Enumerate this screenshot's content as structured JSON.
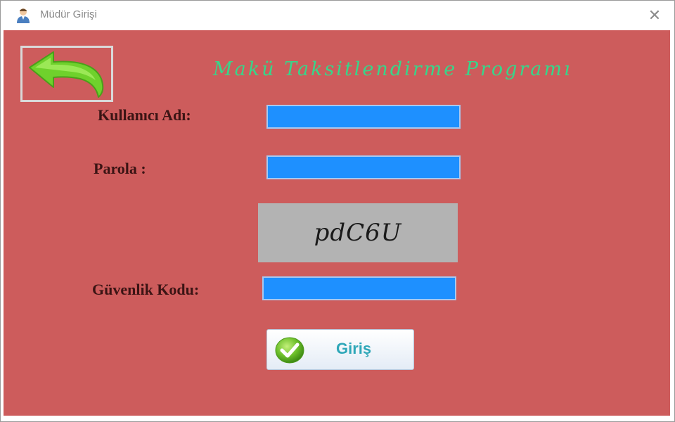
{
  "window": {
    "title": "Müdür Girişi",
    "close_glyph": "✕",
    "icon": "user-avatar-icon"
  },
  "header": {
    "back_icon": "back-arrow-icon",
    "app_title": "Makü Taksitlendirme Programı"
  },
  "form": {
    "username_label": "Kullanıcı Adı:",
    "username_value": "",
    "password_label": "Parola :",
    "password_value": "",
    "captcha_code": "pdC6U",
    "security_label": "Güvenlik Kodu:",
    "security_value": "",
    "login_label": "Giriş",
    "login_icon": "check-icon"
  },
  "colors": {
    "background": "#cd5c5c",
    "field": "#1e90ff",
    "title": "#37d68a",
    "captcha_bg": "#b3b3b3",
    "login_text": "#2ea7b8"
  }
}
